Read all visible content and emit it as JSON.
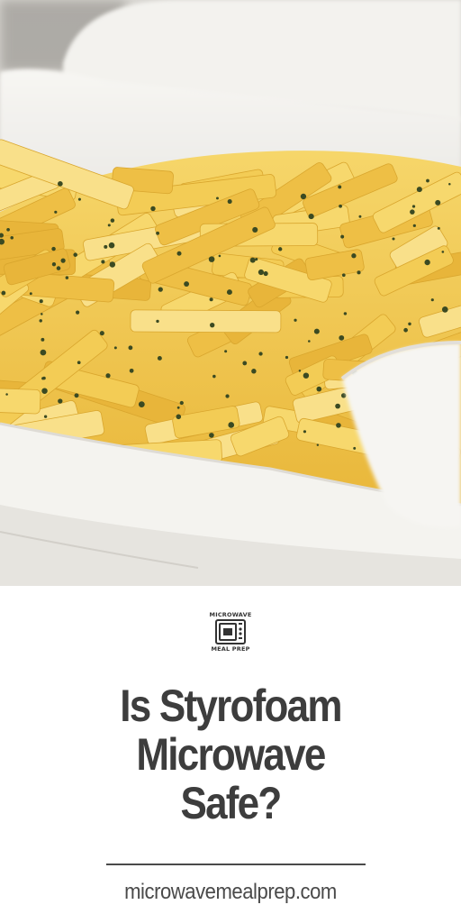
{
  "hero": {
    "icon": "fries-in-styrofoam-container-photo",
    "colors": {
      "container": "#f2f1ed",
      "fries": "#f1c84e",
      "herbs": "#3b4a22"
    }
  },
  "logo": {
    "icon": "microwave-icon",
    "top_text": "MICROWAVE",
    "bottom_text": "MEAL PREP"
  },
  "title": {
    "line1": "Is Styrofoam",
    "line2": "Microwave",
    "line3": "Safe?"
  },
  "site": {
    "url": "microwavemealprep.com"
  }
}
